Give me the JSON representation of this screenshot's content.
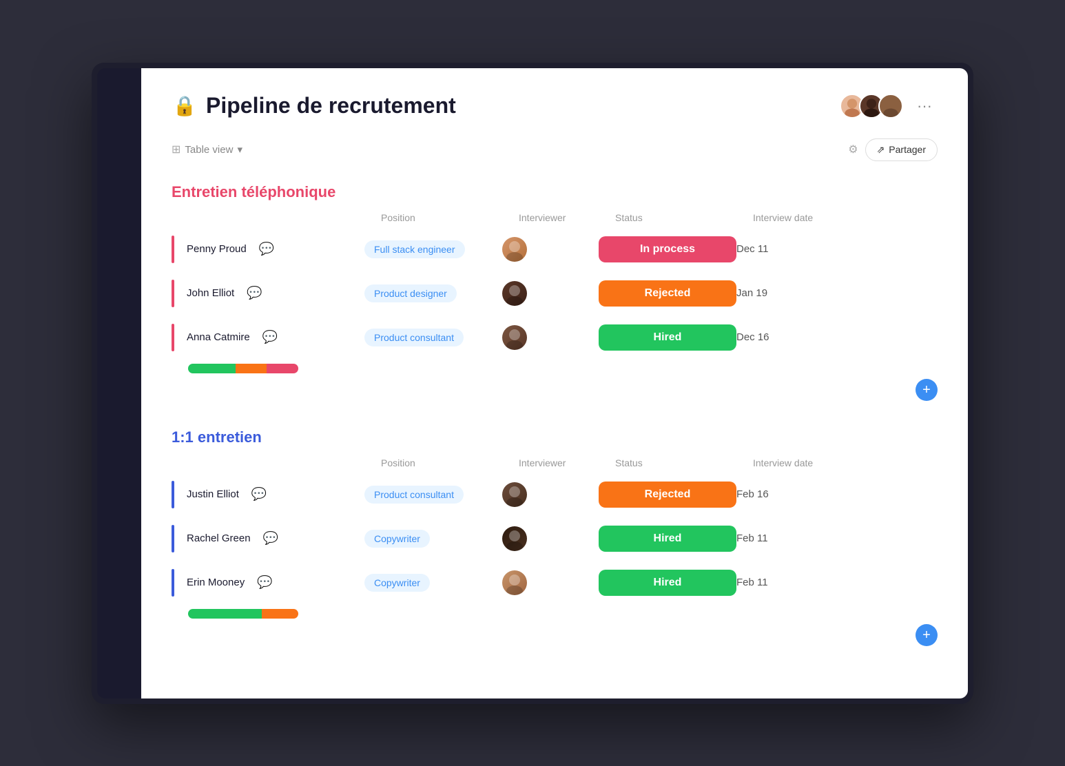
{
  "app": {
    "title": "Pipeline de recrutement",
    "lock_icon": "🔒",
    "dots_label": "···"
  },
  "toolbar": {
    "view_label": "Table view",
    "share_label": "Partager",
    "share_icon": "↗"
  },
  "sections": [
    {
      "id": "telephone",
      "title": "Entretien téléphonique",
      "color": "pink",
      "columns": {
        "name": "",
        "position": "Position",
        "interviewer": "Interviewer",
        "status": "Status",
        "date": "Interview date"
      },
      "rows": [
        {
          "name": "Penny Proud",
          "position": "Full stack engineer",
          "status": "In process",
          "status_class": "status-inprocess",
          "date": "Dec 11",
          "avatar_class": "face-f1"
        },
        {
          "name": "John Elliot",
          "position": "Product designer",
          "status": "Rejected",
          "status_class": "status-rejected",
          "date": "Jan 19",
          "avatar_class": "face-m1"
        },
        {
          "name": "Anna Catmire",
          "position": "Product consultant",
          "status": "Hired",
          "status_class": "status-hired",
          "date": "Dec 16",
          "avatar_class": "face-m2"
        }
      ],
      "progress": [
        {
          "class": "pb-green",
          "flex": 3
        },
        {
          "class": "pb-orange",
          "flex": 2
        },
        {
          "class": "pb-pink",
          "flex": 2
        }
      ]
    },
    {
      "id": "one-on-one",
      "title": "1:1 entretien",
      "color": "blue",
      "columns": {
        "name": "",
        "position": "Position",
        "interviewer": "Interviewer",
        "status": "Status",
        "date": "Interview date"
      },
      "rows": [
        {
          "name": "Justin Elliot",
          "position": "Product consultant",
          "status": "Rejected",
          "status_class": "status-rejected",
          "date": "Feb 16",
          "avatar_class": "face-m3"
        },
        {
          "name": "Rachel Green",
          "position": "Copywriter",
          "status": "Hired",
          "status_class": "status-hired",
          "date": "Feb 11",
          "avatar_class": "face-m4"
        },
        {
          "name": "Erin Mooney",
          "position": "Copywriter",
          "status": "Hired",
          "status_class": "status-hired",
          "date": "Feb 11",
          "avatar_class": "face-f2"
        }
      ],
      "progress": [
        {
          "class": "pb-green",
          "flex": 4
        },
        {
          "class": "pb-orange",
          "flex": 2
        }
      ]
    }
  ]
}
